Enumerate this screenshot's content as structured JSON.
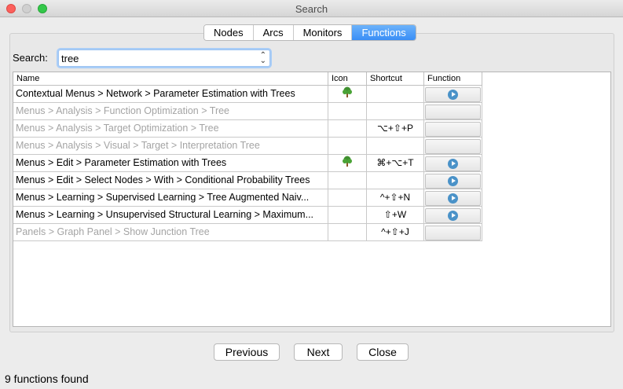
{
  "window": {
    "title": "Search"
  },
  "tabs": [
    {
      "label": "Nodes",
      "active": false
    },
    {
      "label": "Arcs",
      "active": false
    },
    {
      "label": "Monitors",
      "active": false
    },
    {
      "label": "Functions",
      "active": true
    }
  ],
  "search": {
    "label": "Search:",
    "value": "tree"
  },
  "table": {
    "columns": [
      "Name",
      "Icon",
      "Shortcut",
      "Function"
    ],
    "rows": [
      {
        "name": "Contextual Menus > Network > Parameter Estimation with Trees",
        "icon": "tree-icon",
        "shortcut": "",
        "enabled": true,
        "function": "play"
      },
      {
        "name": "Menus > Analysis > Function Optimization > Tree",
        "icon": "",
        "shortcut": "",
        "enabled": false,
        "function": ""
      },
      {
        "name": "Menus > Analysis > Target Optimization > Tree",
        "icon": "",
        "shortcut": "⌥+⇧+P",
        "enabled": false,
        "function": ""
      },
      {
        "name": "Menus > Analysis > Visual > Target > Interpretation Tree",
        "icon": "",
        "shortcut": "",
        "enabled": false,
        "function": ""
      },
      {
        "name": "Menus > Edit > Parameter Estimation with Trees",
        "icon": "tree-icon",
        "shortcut": "⌘+⌥+T",
        "enabled": true,
        "function": "play"
      },
      {
        "name": "Menus > Edit > Select Nodes > With > Conditional Probability Trees",
        "icon": "",
        "shortcut": "",
        "enabled": true,
        "function": "play"
      },
      {
        "name": "Menus > Learning > Supervised Learning > Tree Augmented Naiv...",
        "icon": "",
        "shortcut": "^+⇧+N",
        "enabled": true,
        "function": "play"
      },
      {
        "name": "Menus > Learning > Unsupervised Structural Learning > Maximum...",
        "icon": "",
        "shortcut": "⇧+W",
        "enabled": true,
        "function": "play"
      },
      {
        "name": "Panels > Graph Panel > Show Junction Tree",
        "icon": "",
        "shortcut": "^+⇧+J",
        "enabled": false,
        "function": ""
      }
    ]
  },
  "buttons": {
    "previous": "Previous",
    "next": "Next",
    "close": "Close"
  },
  "status": "9 functions found",
  "colors": {
    "accent": "#3a8ef6",
    "play": "#4a92c8",
    "disabled_text": "#a4a4a4"
  }
}
